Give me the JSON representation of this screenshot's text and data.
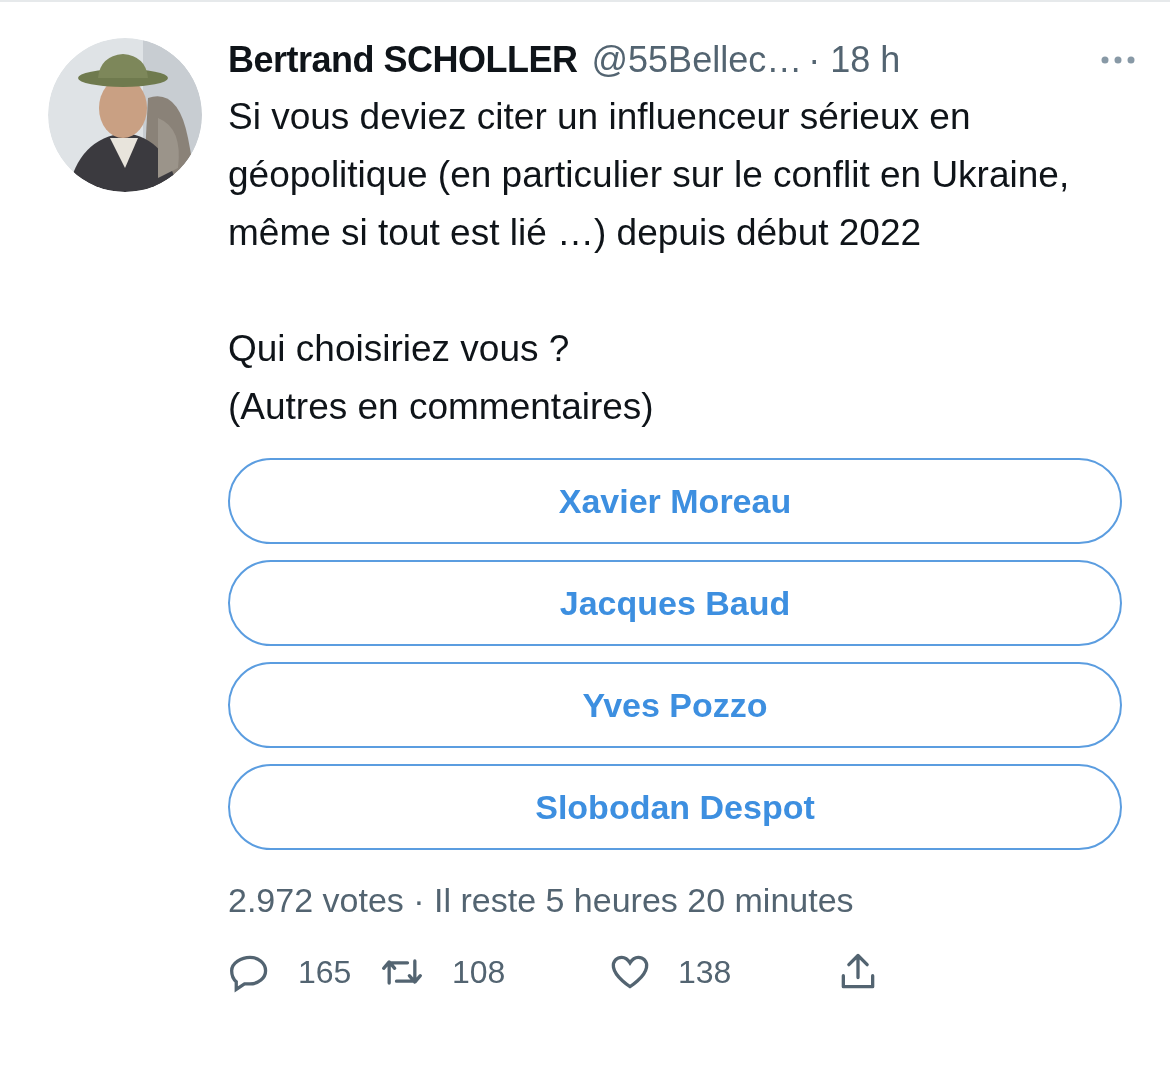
{
  "tweet": {
    "author_name": "Bertrand SCHOLLER",
    "handle": "@55Bellec…",
    "time": "· 18 h",
    "text": "Si vous deviez citer un influenceur sérieux en géopolitique (en particulier sur le conflit en Ukraine, même si tout est lié …) depuis début 2022\n\nQui choisiriez vous ?\n(Autres en commentaires)",
    "poll": {
      "options": [
        {
          "label": "Xavier Moreau"
        },
        {
          "label": "Jacques Baud"
        },
        {
          "label": "Yves Pozzo"
        },
        {
          "label": "Slobodan Despot"
        }
      ],
      "summary": "2.972 votes · Il reste 5 heures 20 minutes"
    },
    "actions": [
      {
        "kind": "reply",
        "count": "165"
      },
      {
        "kind": "retweet",
        "count": "108"
      },
      {
        "kind": "like",
        "count": "138"
      },
      {
        "kind": "share"
      }
    ]
  }
}
